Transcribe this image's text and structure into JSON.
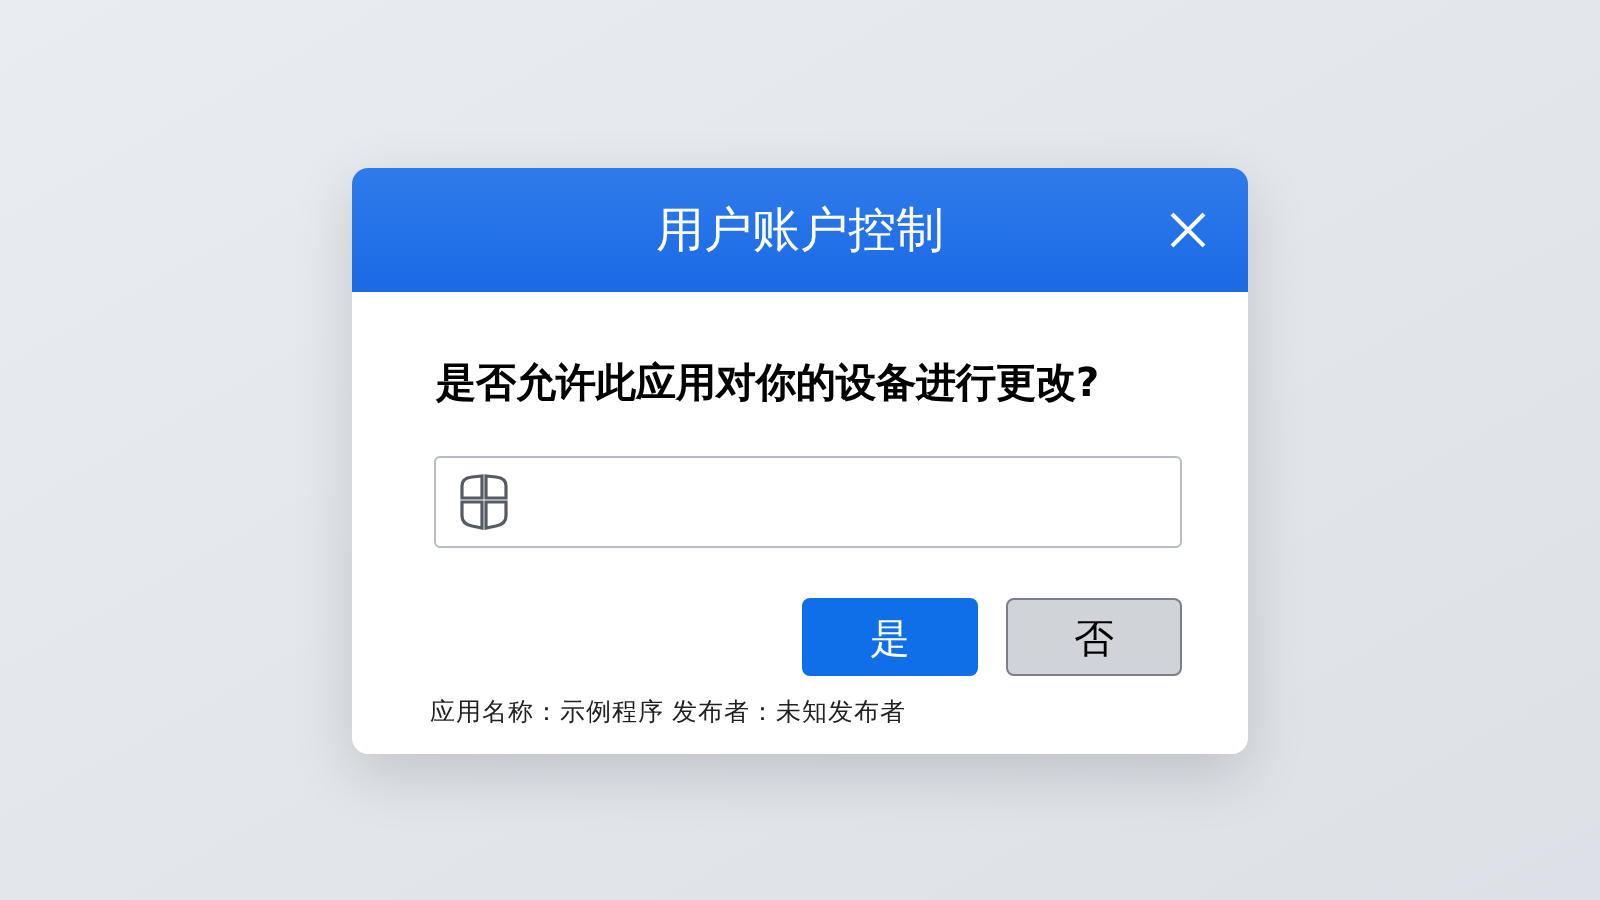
{
  "dialog": {
    "title": "用户账户控制",
    "question": "是否允许此应用对你的设备进行更改?",
    "buttons": [
      {
        "label": "是",
        "kind": "primary"
      },
      {
        "label": "否",
        "kind": "secondary"
      }
    ],
    "details": "应用名称：示例程序 发布者：未知发布者"
  }
}
